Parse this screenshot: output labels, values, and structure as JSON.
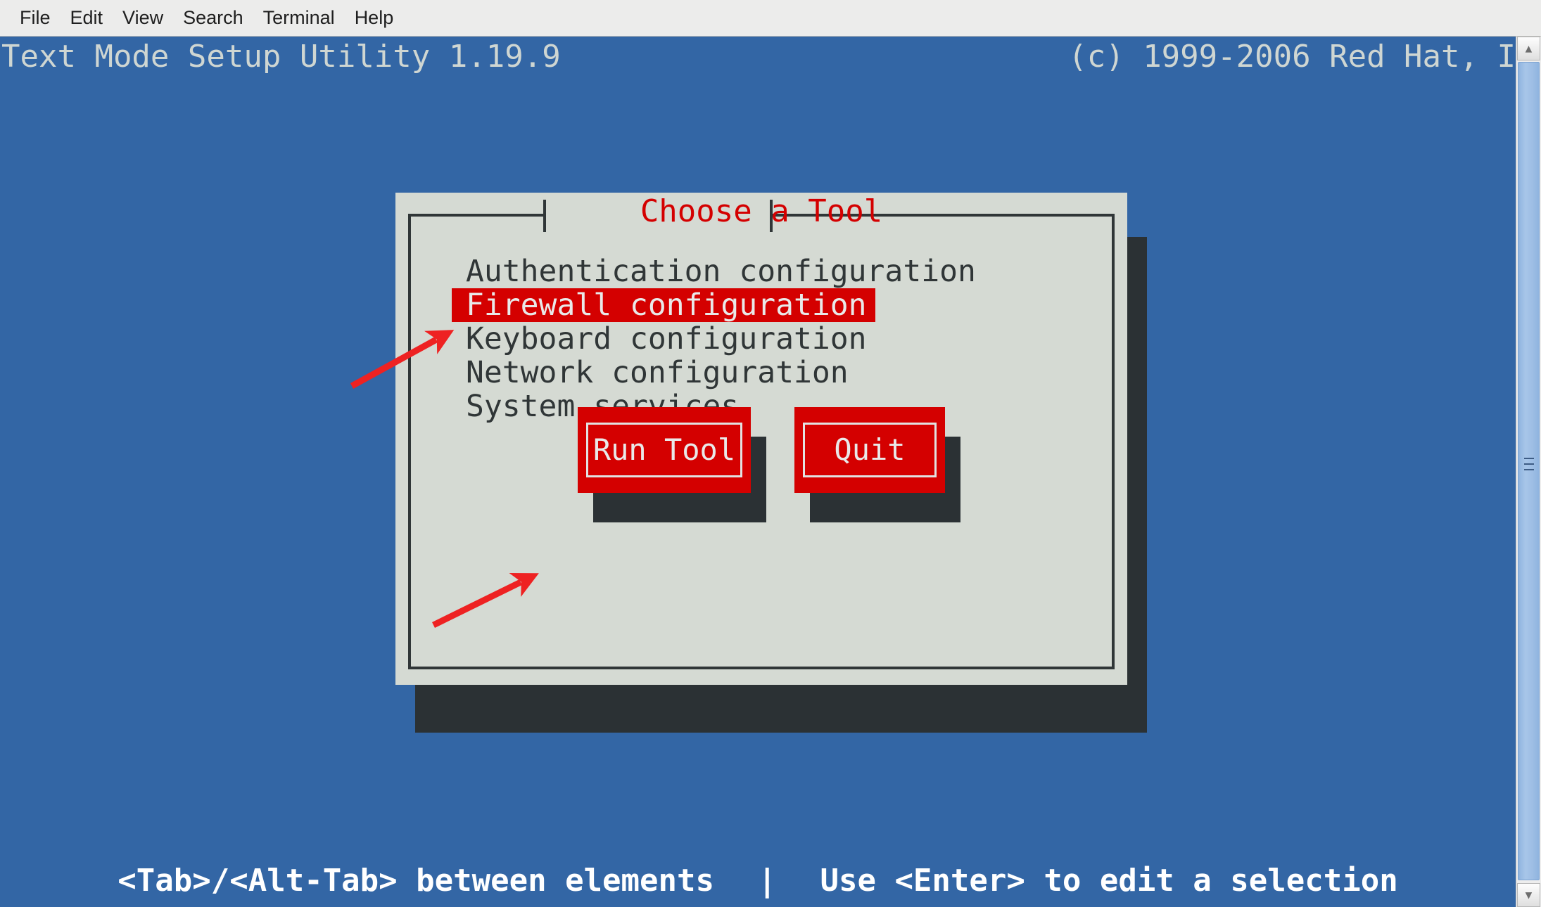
{
  "menubar": {
    "items": [
      {
        "label": "File"
      },
      {
        "label": "Edit"
      },
      {
        "label": "View"
      },
      {
        "label": "Search"
      },
      {
        "label": "Terminal"
      },
      {
        "label": "Help"
      }
    ]
  },
  "terminal": {
    "title": "Text Mode Setup Utility 1.19.9",
    "copyright": "(c) 1999-2006 Red Hat, I",
    "background_color": "#3366a5",
    "foreground_color": "#cfd6d2"
  },
  "dialog": {
    "title": "Choose a Tool",
    "title_color": "#d40000",
    "background_color": "#d5dad3",
    "border_color": "#303637",
    "shadow_color": "#2b3134",
    "items": [
      {
        "label": "Authentication configuration",
        "selected": false
      },
      {
        "label": "Firewall configuration",
        "selected": true
      },
      {
        "label": "Keyboard configuration",
        "selected": false
      },
      {
        "label": "Network configuration",
        "selected": false
      },
      {
        "label": "System services",
        "selected": false
      }
    ],
    "selection_color": "#d40000",
    "buttons": [
      {
        "label": "Run Tool",
        "name": "run-tool-button"
      },
      {
        "label": "Quit",
        "name": "quit-button"
      }
    ]
  },
  "helpbar": {
    "left": "<Tab>/<Alt-Tab> between elements",
    "separator": "|",
    "right": "Use <Enter> to edit a selection"
  },
  "scrollbar": {
    "up_arrow": "▲",
    "down_arrow": "▼"
  },
  "annotations": {
    "color": "#ee2222",
    "arrow_1_target": "Firewall configuration",
    "arrow_2_target": "Run Tool"
  }
}
